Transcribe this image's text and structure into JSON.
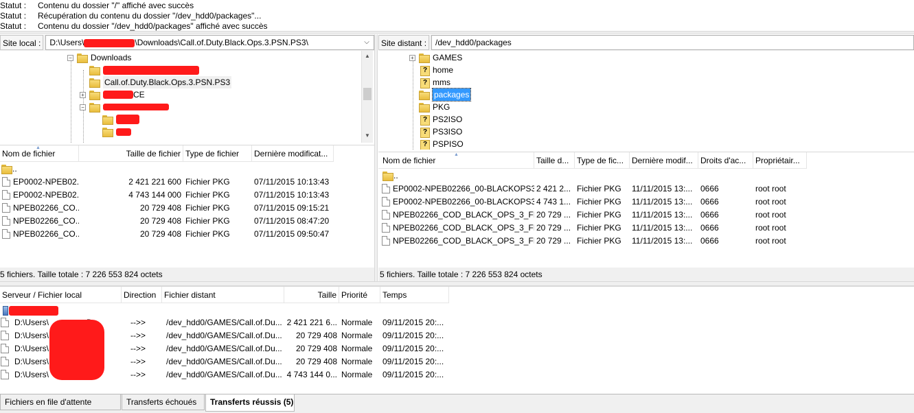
{
  "log": [
    {
      "label": "Statut :",
      "message": "Contenu du dossier \"/\" affiché avec succès"
    },
    {
      "label": "Statut :",
      "message": "Récupération du contenu du dossier \"/dev_hdd0/packages\"..."
    },
    {
      "label": "Statut :",
      "message": "Contenu du dossier \"/dev_hdd0/packages\" affiché avec succès"
    }
  ],
  "local": {
    "site_label": "Site local :",
    "path_prefix": "D:\\Users\\",
    "path_suffix": "\\Downloads\\Call.of.Duty.Black.Ops.3.PSN.PS3\\",
    "tree": [
      {
        "label": "Downloads"
      },
      {
        "label": ""
      },
      {
        "label": "Call.of.Duty.Black.Ops.3.PSN.PS3"
      },
      {
        "label": "CE"
      },
      {
        "label": ""
      },
      {
        "label": ""
      },
      {
        "label": ""
      }
    ],
    "columns": [
      "Nom de fichier",
      "Taille de fichier",
      "Type de fichier",
      "Dernière modificat..."
    ],
    "files": [
      {
        "name": "..",
        "size": "",
        "type": "",
        "modified": ""
      },
      {
        "name": "EP0002-NPEB02...",
        "size": "2 421 221 600",
        "type": "Fichier PKG",
        "modified": "07/11/2015 10:13:43"
      },
      {
        "name": "EP0002-NPEB02...",
        "size": "4 743 144 000",
        "type": "Fichier PKG",
        "modified": "07/11/2015 10:13:43"
      },
      {
        "name": "NPEB02266_CO...",
        "size": "20 729 408",
        "type": "Fichier PKG",
        "modified": "07/11/2015 09:15:21"
      },
      {
        "name": "NPEB02266_CO...",
        "size": "20 729 408",
        "type": "Fichier PKG",
        "modified": "07/11/2015 08:47:20"
      },
      {
        "name": "NPEB02266_CO...",
        "size": "20 729 408",
        "type": "Fichier PKG",
        "modified": "07/11/2015 09:50:47"
      }
    ],
    "status": "5 fichiers. Taille totale : 7 226 553 824 octets"
  },
  "remote": {
    "site_label": "Site distant :",
    "path": "/dev_hdd0/packages",
    "tree": [
      {
        "label": "GAMES",
        "kind": "folder",
        "expander": "+"
      },
      {
        "label": "home",
        "kind": "unknown"
      },
      {
        "label": "mms",
        "kind": "unknown"
      },
      {
        "label": "packages",
        "kind": "folder",
        "selected": true
      },
      {
        "label": "PKG",
        "kind": "folder"
      },
      {
        "label": "PS2ISO",
        "kind": "unknown"
      },
      {
        "label": "PS3ISO",
        "kind": "unknown"
      },
      {
        "label": "PSPISO",
        "kind": "unknown"
      }
    ],
    "columns": [
      "Nom de fichier",
      "Taille d...",
      "Type de fic...",
      "Dernière modif...",
      "Droits d'ac...",
      "Propriétair..."
    ],
    "files": [
      {
        "name": "..",
        "size": "",
        "type": "",
        "modified": "",
        "perms": "",
        "owner": ""
      },
      {
        "name": "EP0002-NPEB02266_00-BLACKOPS3...",
        "size": "2 421 2...",
        "type": "Fichier PKG",
        "modified": "11/11/2015 13:...",
        "perms": "0666",
        "owner": "root root"
      },
      {
        "name": "EP0002-NPEB02266_00-BLACKOPS3...",
        "size": "4 743 1...",
        "type": "Fichier PKG",
        "modified": "11/11/2015 13:...",
        "perms": "0666",
        "owner": "root root"
      },
      {
        "name": "NPEB02266_COD_BLACK_OPS_3_FIX...",
        "size": "20 729 ...",
        "type": "Fichier PKG",
        "modified": "11/11/2015 13:...",
        "perms": "0666",
        "owner": "root root"
      },
      {
        "name": "NPEB02266_COD_BLACK_OPS_3_FIX...",
        "size": "20 729 ...",
        "type": "Fichier PKG",
        "modified": "11/11/2015 13:...",
        "perms": "0666",
        "owner": "root root"
      },
      {
        "name": "NPEB02266_COD_BLACK_OPS_3_FIX...",
        "size": "20 729 ...",
        "type": "Fichier PKG",
        "modified": "11/11/2015 13:...",
        "perms": "0666",
        "owner": "root root"
      }
    ],
    "status": "5 fichiers. Taille totale : 7 226 553 824 octets"
  },
  "queue": {
    "columns": [
      "Serveur / Fichier local",
      "Direction",
      "Fichier distant",
      "Taille",
      "Priorité",
      "Temps"
    ],
    "rows": [
      {
        "local": "D:\\Users\\",
        "local_tail": "D...",
        "direction": "-->>",
        "remote": "/dev_hdd0/GAMES/Call.of.Du...",
        "size": "2 421 221 6...",
        "priority": "Normale",
        "time": "09/11/2015 20:..."
      },
      {
        "local": "D:\\Users\\",
        "local_tail": "D...",
        "direction": "-->>",
        "remote": "/dev_hdd0/GAMES/Call.of.Du...",
        "size": "20 729 408",
        "priority": "Normale",
        "time": "09/11/2015 20:..."
      },
      {
        "local": "D:\\Users\\",
        "local_tail": "D...",
        "direction": "-->>",
        "remote": "/dev_hdd0/GAMES/Call.of.Du...",
        "size": "20 729 408",
        "priority": "Normale",
        "time": "09/11/2015 20:..."
      },
      {
        "local": "D:\\Users\\",
        "local_tail": "D...",
        "direction": "-->>",
        "remote": "/dev_hdd0/GAMES/Call.of.Du...",
        "size": "20 729 408",
        "priority": "Normale",
        "time": "09/11/2015 20:..."
      },
      {
        "local": "D:\\Users\\",
        "local_tail": "D...",
        "direction": "-->>",
        "remote": "/dev_hdd0/GAMES/Call.of.Du...",
        "size": "4 743 144 0...",
        "priority": "Normale",
        "time": "09/11/2015 20:..."
      }
    ]
  },
  "tabs": [
    "Fichiers en file d'attente",
    "Transferts échoués",
    "Transferts réussis (5)"
  ],
  "colors": {
    "redaction": "#ff1a1a",
    "selection": "#3399ff",
    "panel_bg": "#f0f0f0"
  }
}
